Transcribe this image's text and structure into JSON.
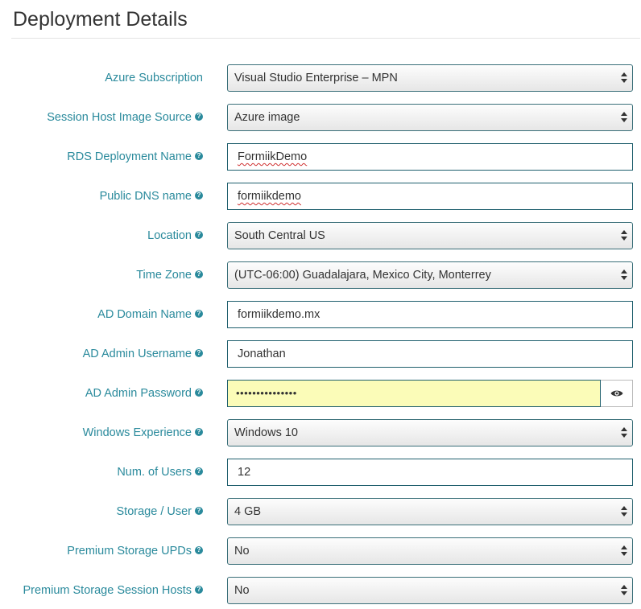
{
  "page": {
    "title": "Deployment Details"
  },
  "form": {
    "rows": [
      {
        "label": "Azure Subscription",
        "value": "Visual Studio Enterprise – MPN",
        "type": "select",
        "help": false
      },
      {
        "label": "Session Host Image Source",
        "value": "Azure image",
        "type": "select",
        "help": true
      },
      {
        "label": "RDS Deployment Name",
        "value": "FormiikDemo",
        "type": "input",
        "help": true
      },
      {
        "label": "Public DNS name",
        "value": "formiikdemo",
        "type": "input",
        "help": true
      },
      {
        "label": "Location",
        "value": "South Central US",
        "type": "select",
        "help": true
      },
      {
        "label": "Time Zone",
        "value": "(UTC-06:00) Guadalajara, Mexico City, Monterrey",
        "type": "select",
        "help": true
      },
      {
        "label": "AD Domain Name",
        "value": "formiikdemo.mx",
        "type": "input",
        "help": true
      },
      {
        "label": "AD Admin Username",
        "value": "Jonathan",
        "type": "input",
        "help": true
      },
      {
        "label": "AD Admin Password",
        "value": "•••••••••••••••",
        "type": "password",
        "help": true
      },
      {
        "label": "Windows Experience",
        "value": "Windows 10",
        "type": "select",
        "help": true
      },
      {
        "label": "Num. of Users",
        "value": "12",
        "type": "input",
        "help": true
      },
      {
        "label": "Storage / User",
        "value": "4 GB",
        "type": "select",
        "help": true
      },
      {
        "label": "Premium Storage UPDs",
        "value": "No",
        "type": "select",
        "help": true
      },
      {
        "label": "Premium Storage Session Hosts",
        "value": "No",
        "type": "select",
        "help": true
      }
    ]
  },
  "icons": {
    "help": "question-circle-icon",
    "reveal": "eye-icon",
    "select_arrows": "up-down-arrows-icon"
  },
  "colors": {
    "label": "#2a8a9c",
    "field_border": "#1f5f6d",
    "autofill": "#fbfcb8"
  }
}
